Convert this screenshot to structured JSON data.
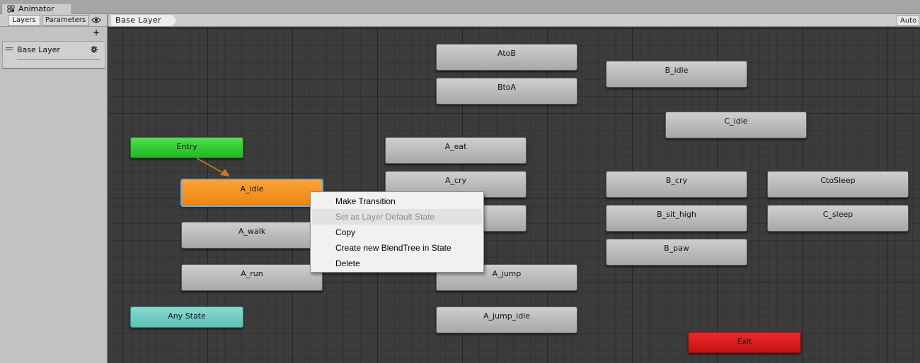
{
  "window": {
    "title": "Animator"
  },
  "left_panel": {
    "tabs": [
      "Layers",
      "Parameters"
    ],
    "eye_icon": "eye-icon",
    "add_label": "+",
    "layers": [
      {
        "name": "Base Layer"
      }
    ]
  },
  "breadcrumb": {
    "label": "Base Layer"
  },
  "auto_button": {
    "label": "Auto"
  },
  "graph": {
    "nodes": {
      "entry": "Entry",
      "any_state": "Any State",
      "exit": "Exit",
      "a_idle": "A_idle",
      "a_walk": "A_walk",
      "a_run": "A_run",
      "atob": "AtoB",
      "btoa": "BtoA",
      "a_eat": "A_eat",
      "a_cry": "A_cry",
      "a_jump": "A_jump",
      "a_jump_idle": "A_jump_idle",
      "b_idle": "B_idle",
      "c_idle": "C_idle",
      "b_cry": "B_cry",
      "b_sit_high": "B_sit_high",
      "b_paw": "B_paw",
      "ctosleep": "CtoSleep",
      "c_sleep": "C_sleep"
    },
    "selected_node": "A_idle",
    "colors": {
      "entry": "#2ccb2c",
      "any_state": "#6fcfc1",
      "exit": "#d81c1c",
      "selected": "#f39422",
      "state": "#bcbcbc"
    }
  },
  "context_menu": {
    "items": [
      {
        "label": "Make Transition",
        "enabled": true
      },
      {
        "label": "Set as Layer Default State",
        "enabled": false
      },
      {
        "label": "Copy",
        "enabled": true
      },
      {
        "label": "Create new BlendTree in State",
        "enabled": true
      },
      {
        "label": "Delete",
        "enabled": true
      }
    ]
  }
}
